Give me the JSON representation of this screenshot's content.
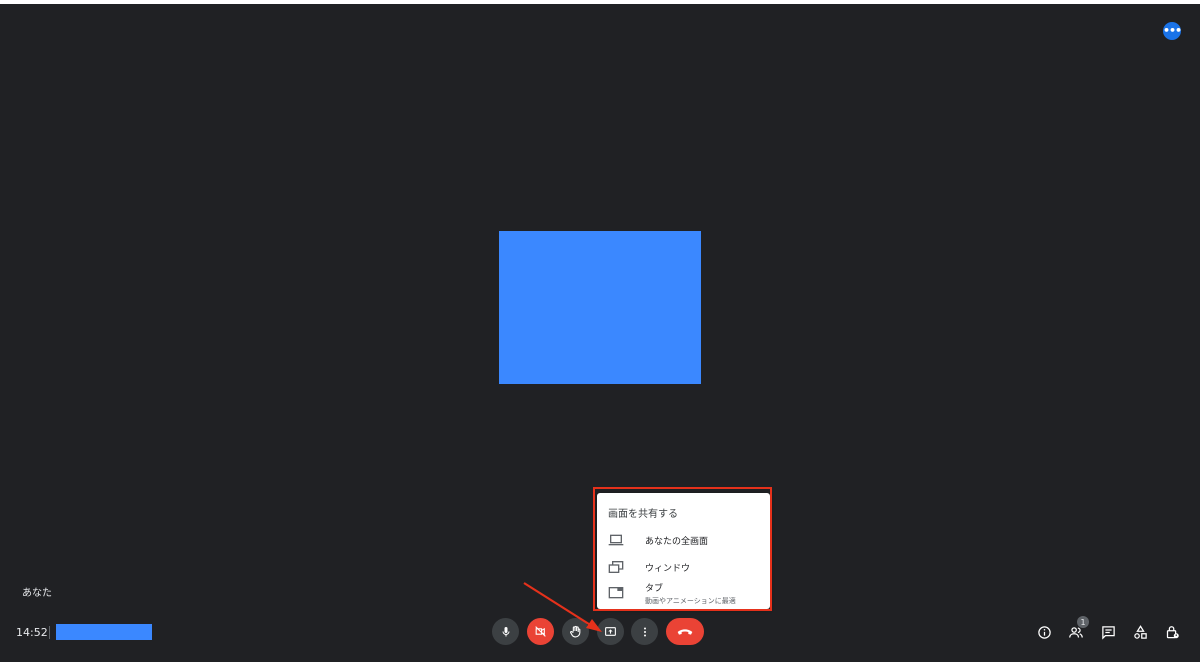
{
  "participant": {
    "name": "あなた"
  },
  "footer": {
    "time": "14:52"
  },
  "people_count": "1",
  "share_menu": {
    "title": "画面を共有する",
    "items": [
      {
        "label": "あなたの全画面",
        "icon": "laptop-icon"
      },
      {
        "label": "ウィンドウ",
        "icon": "window-icon"
      },
      {
        "label": "タブ",
        "sublabel": "動画やアニメーションに最適",
        "icon": "tab-icon"
      }
    ]
  },
  "colors": {
    "background": "#202124",
    "accent_blue": "#3b88ff",
    "danger_red": "#ea4335",
    "annotation_red": "#e5311b"
  }
}
